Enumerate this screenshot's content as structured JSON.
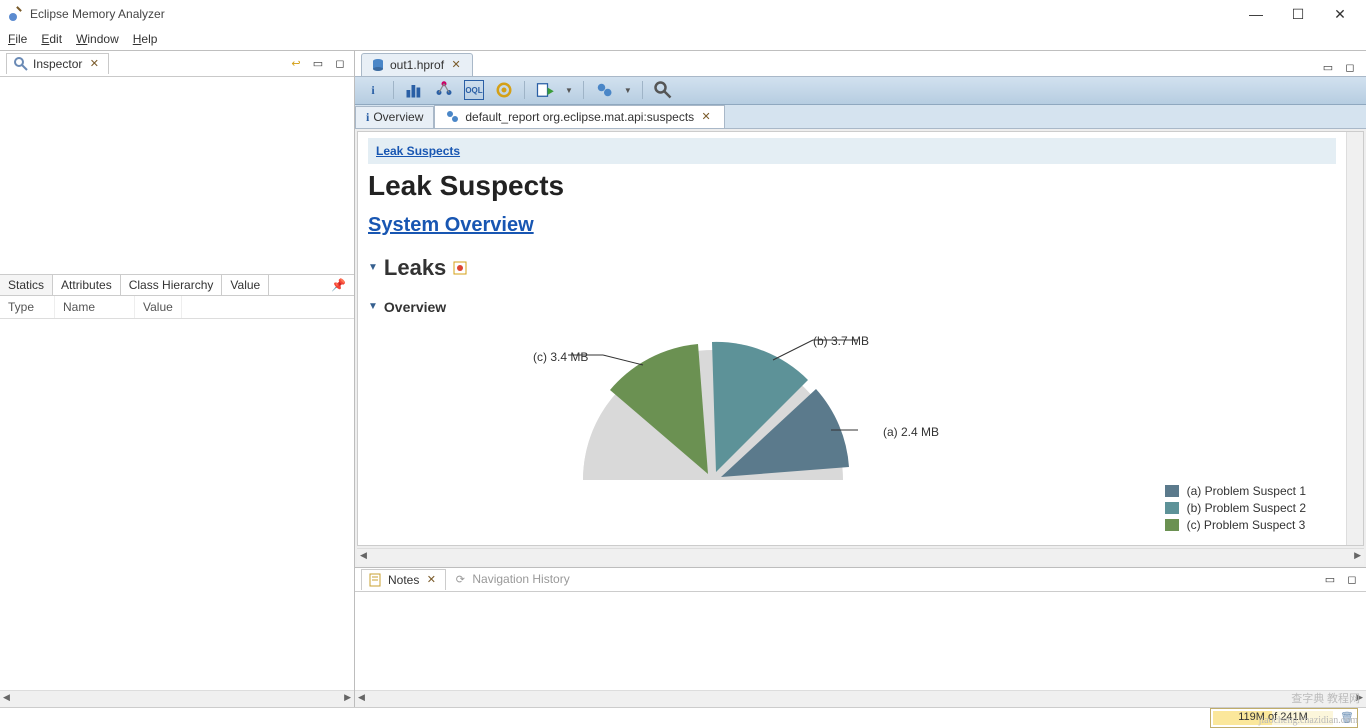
{
  "app": {
    "title": "Eclipse Memory Analyzer"
  },
  "menus": {
    "file": "File",
    "edit": "Edit",
    "window": "Window",
    "help": "Help"
  },
  "inspector": {
    "title": "Inspector",
    "tabs": {
      "statics": "Statics",
      "attributes": "Attributes",
      "classHierarchy": "Class Hierarchy",
      "value": "Value"
    },
    "columns": {
      "type": "Type",
      "name": "Name",
      "value": "Value"
    }
  },
  "editor": {
    "file": "out1.hprof"
  },
  "subtabs": {
    "overview": "Overview",
    "report": "default_report  org.eclipse.mat.api:suspects"
  },
  "report": {
    "breadcrumb": "Leak Suspects",
    "heading": "Leak Suspects",
    "systemOverview": "System Overview",
    "leaksLabel": "Leaks",
    "overviewLabel": "Overview"
  },
  "chart_data": {
    "type": "pie",
    "series": [
      {
        "id": "a",
        "name": "Problem Suspect 1",
        "value_mb": 2.4,
        "color": "#5b7a8c",
        "label": "(a)  2.4 MB",
        "legend": "(a)  Problem Suspect 1"
      },
      {
        "id": "b",
        "name": "Problem Suspect 2",
        "value_mb": 3.7,
        "color": "#5d9298",
        "label": "(b)  3.7 MB",
        "legend": "(b)  Problem Suspect 2"
      },
      {
        "id": "c",
        "name": "Problem Suspect 3",
        "value_mb": 3.4,
        "color": "#6b9152",
        "label": "(c)  3.4 MB",
        "legend": "(c)  Problem Suspect 3"
      }
    ],
    "remainder_color": "#d9d9d9"
  },
  "bottom": {
    "notes": "Notes",
    "navHistory": "Navigation History"
  },
  "status": {
    "heap": "119M of 241M"
  },
  "watermark": "jiaocheng.chazidian.com",
  "watermark2": "查字典 教程网"
}
